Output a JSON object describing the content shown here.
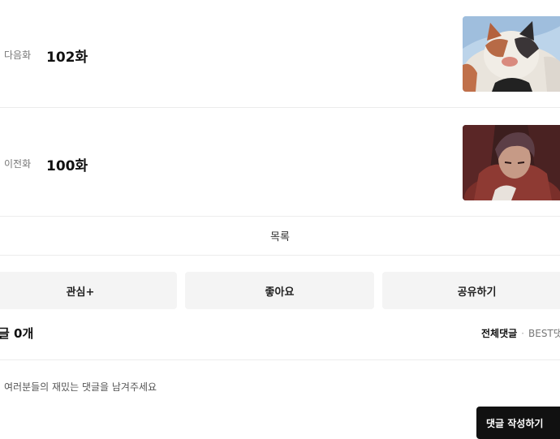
{
  "episodes": [
    {
      "kind": "다음화",
      "title": "102화"
    },
    {
      "kind": "이전화",
      "title": "100화"
    }
  ],
  "list_label": "목록",
  "actions": [
    "관심+",
    "좋아요",
    "공유하기"
  ],
  "comments": {
    "count_label": "글 0개",
    "sort_all": "전체댓글",
    "sort_separator": "·",
    "sort_best": "BEST댓",
    "placeholder": "여러분들의 재밌는 댓글을 남겨주세요",
    "write_button": "댓글 작성하기"
  }
}
